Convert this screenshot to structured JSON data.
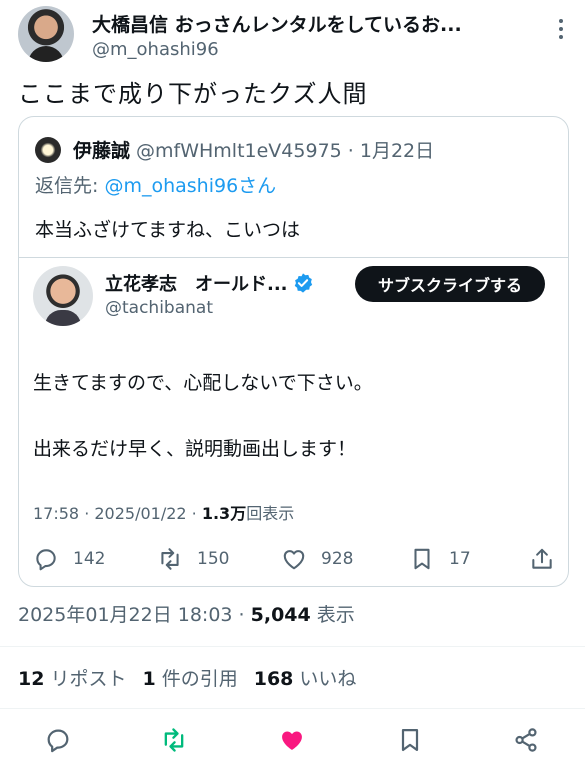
{
  "author": {
    "name": "大橋昌信 おっさんレンタルをしているお...",
    "handle": "@m_ohashi96"
  },
  "tweet": {
    "text": "ここまで成り下がったクズ人間"
  },
  "quote": {
    "name": "伊藤誠",
    "meta": "@mfWHmlt1eV45975 · 1月22日",
    "reply_prefix": "返信先: ",
    "reply_to": "@m_ohashi96さん",
    "body": "本当ふざけてますね、こいつは"
  },
  "inner": {
    "name": "立花孝志　オールド...",
    "handle": "@tachibanat",
    "subscribe_label": "サブスクライブする",
    "line1": "生きてますので、心配しないで下さい。",
    "line2": "出来るだけ早く、説明動画出します！",
    "time": "17:58 · 2025/01/22 · ",
    "views_count": "1.3万",
    "views_label": "回表示",
    "replies": "142",
    "retweets": "150",
    "likes": "928",
    "bookmarks": "17"
  },
  "post_meta": {
    "timestamp": "2025年01月22日 18:03 · ",
    "views_count": "5,044",
    "views_label": " 表示"
  },
  "stats": {
    "reposts_count": "12",
    "reposts_label": "リポスト",
    "quotes_count": "1",
    "quotes_label": "件の引用",
    "likes_count": "168",
    "likes_label": "いいね"
  },
  "colors": {
    "accent": "#1d9bf0",
    "like_active": "#f91880",
    "retweet": "#00ba7c",
    "secondary_text": "#536471"
  },
  "icons": [
    "more-vertical-icon",
    "verified-badge-icon",
    "reply-icon",
    "retweet-icon",
    "like-icon",
    "bookmark-icon",
    "share-icon"
  ]
}
